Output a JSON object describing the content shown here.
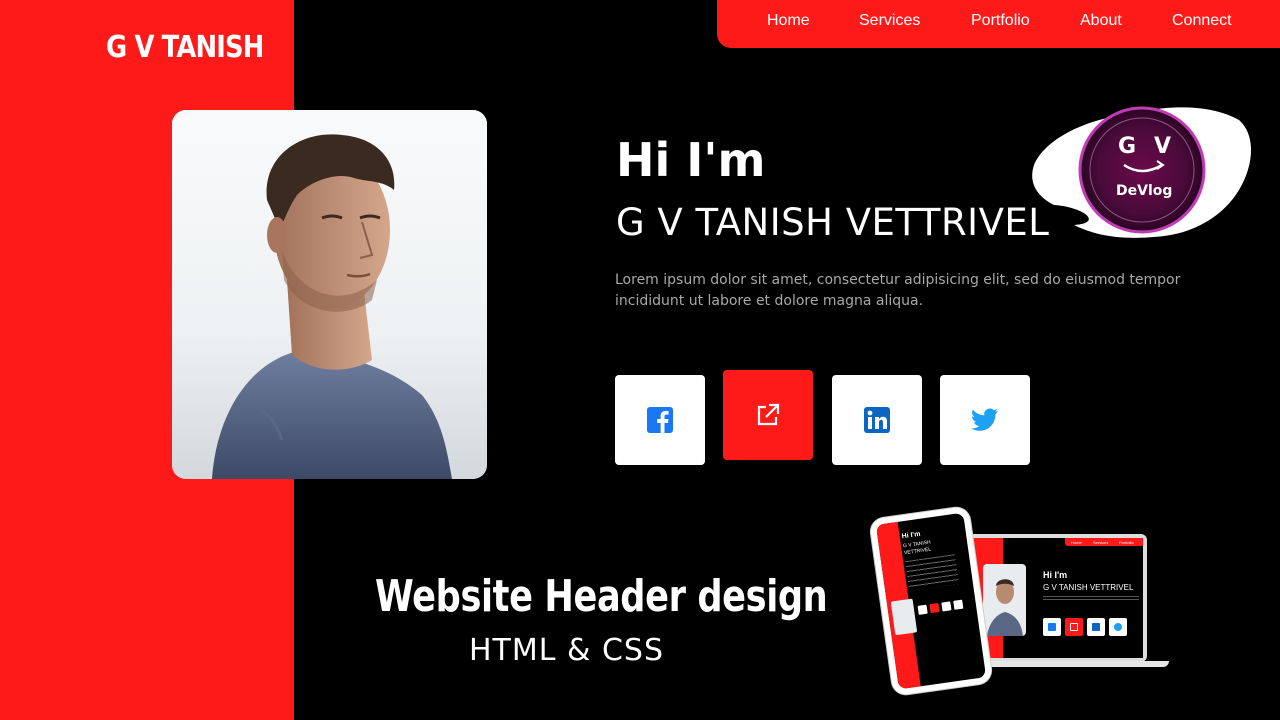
{
  "brand": {
    "name": "G V TANISH"
  },
  "nav": {
    "items": [
      {
        "label": "Home"
      },
      {
        "label": "Services"
      },
      {
        "label": "Portfolio"
      },
      {
        "label": "About"
      },
      {
        "label": "Connect"
      }
    ]
  },
  "hero": {
    "greeting": "Hi I'm",
    "name": "G V TANISH VETTRIVEL",
    "description": "Lorem ipsum dolor sit amet, consectetur adipisicing elit, sed do eiusmod tempor incididunt ut labore et dolore magna aliqua."
  },
  "social": [
    {
      "icon": "facebook-icon",
      "color": "#1877f2",
      "active": false
    },
    {
      "icon": "external-link-icon",
      "color": "#ffffff",
      "active": true
    },
    {
      "icon": "linkedin-icon",
      "color": "#0a66c2",
      "active": false
    },
    {
      "icon": "twitter-icon",
      "color": "#1da1f2",
      "active": false
    }
  ],
  "logo": {
    "letters": "G   V",
    "label": "DeVlog"
  },
  "promo": {
    "title": "Website Header design",
    "subtitle": "HTML & CSS"
  },
  "mockup": {
    "greeting": "Hi I'm",
    "name": "G V TANISH VETTRIVEL",
    "phone_name_line1": "G V TANISH",
    "phone_name_line2": "VETTRIVEL",
    "nav": [
      "Home",
      "Services",
      "Portfolio"
    ]
  },
  "colors": {
    "accent": "#ff1a1a",
    "background": "#000000",
    "muted_text": "#a8a8a8"
  }
}
